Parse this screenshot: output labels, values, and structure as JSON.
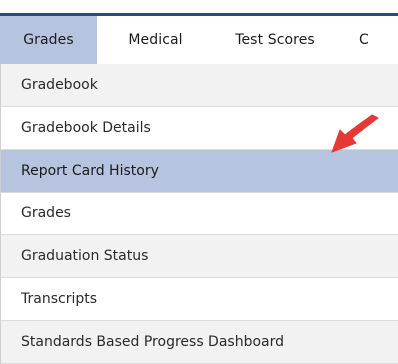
{
  "menubar": {
    "tabs": [
      {
        "label": "Grades",
        "active": true
      },
      {
        "label": "Medical",
        "active": false
      },
      {
        "label": "Test Scores",
        "active": false
      },
      {
        "label": "C",
        "active": false
      }
    ]
  },
  "dropdown": {
    "items": [
      {
        "label": "Gradebook"
      },
      {
        "label": "Gradebook Details"
      },
      {
        "label": "Report Card History"
      },
      {
        "label": "Grades"
      },
      {
        "label": "Graduation Status"
      },
      {
        "label": "Transcripts"
      },
      {
        "label": "Standards Based Progress Dashboard"
      }
    ],
    "highlighted_label": "Report Card History"
  },
  "colors": {
    "active_tab": "#b7c4df",
    "highlight_row": "#b7c4df",
    "alt_row": "#f2f2f2",
    "menubar_line": "#2d4a7a",
    "arrow": "#e53935"
  },
  "icons": {
    "pointer": "red-arrow-icon"
  }
}
